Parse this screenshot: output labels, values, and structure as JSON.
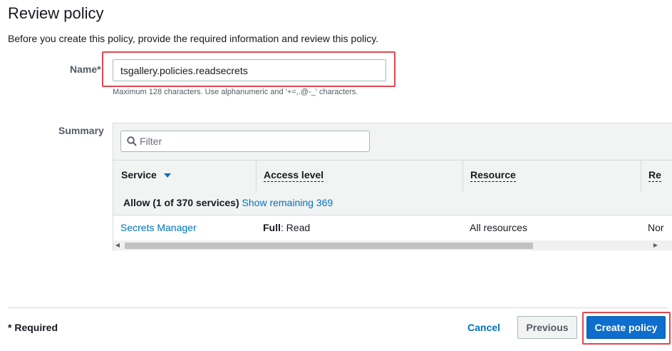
{
  "page": {
    "title": "Review policy",
    "subtitle": "Before you create this policy, provide the required information and review this policy."
  },
  "name_field": {
    "label": "Name*",
    "value": "tsgallery.policies.readsecrets",
    "hint": "Maximum 128 characters. Use alphanumeric and '+=,.@-_' characters."
  },
  "summary": {
    "label": "Summary",
    "filter_placeholder": "Filter",
    "columns": [
      "Service",
      "Access level",
      "Resource",
      "Re"
    ],
    "group": {
      "label": "Allow (1 of 370 services)",
      "link": "Show remaining 369"
    },
    "rows": [
      {
        "service": "Secrets Manager",
        "access_level_bold": "Full",
        "access_level_rest": ": Read",
        "resource": "All resources",
        "request_condition": "Nor"
      }
    ]
  },
  "footer": {
    "required": "* Required",
    "cancel": "Cancel",
    "previous": "Previous",
    "create": "Create policy"
  },
  "colors": {
    "link": "#0073bb",
    "primary_button": "#0d6ecd",
    "highlight_box": "#e0484e",
    "table_header_bg": "#f2f3f3"
  }
}
